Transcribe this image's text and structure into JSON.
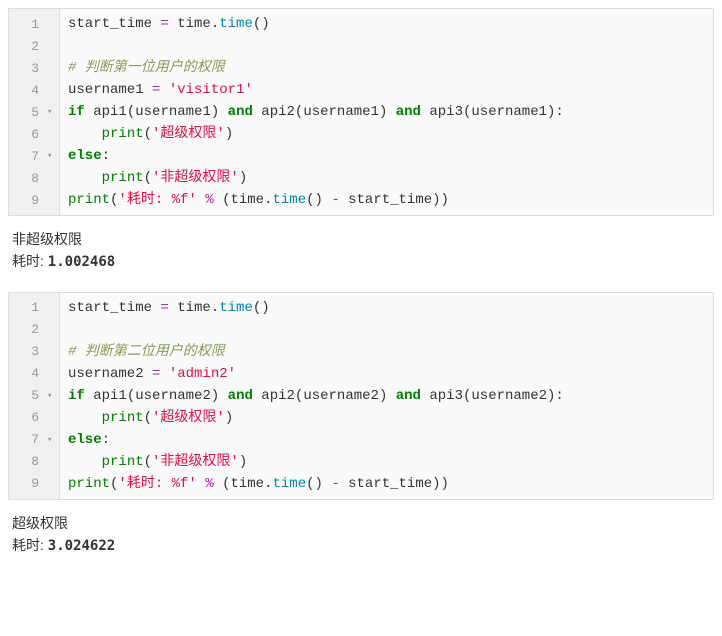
{
  "blocks": [
    {
      "lines": [
        {
          "n": "1",
          "fold": "",
          "tokens": [
            [
              "name",
              "start_time "
            ],
            [
              "op",
              "="
            ],
            [
              "name",
              " time"
            ],
            [
              "punc",
              "."
            ],
            [
              "call",
              "time"
            ],
            [
              "punc",
              "()"
            ]
          ]
        },
        {
          "n": "2",
          "fold": "",
          "tokens": []
        },
        {
          "n": "3",
          "fold": "",
          "tokens": [
            [
              "cmt",
              "# 判断第一位用户的权限"
            ]
          ]
        },
        {
          "n": "4",
          "fold": "",
          "tokens": [
            [
              "name",
              "username1 "
            ],
            [
              "op",
              "="
            ],
            [
              "name",
              " "
            ],
            [
              "str",
              "'visitor1'"
            ]
          ]
        },
        {
          "n": "5",
          "fold": "▾",
          "tokens": [
            [
              "kw",
              "if"
            ],
            [
              "name",
              " api1"
            ],
            [
              "punc",
              "("
            ],
            [
              "name",
              "username1"
            ],
            [
              "punc",
              ")"
            ],
            [
              "name",
              " "
            ],
            [
              "kw",
              "and"
            ],
            [
              "name",
              " api2"
            ],
            [
              "punc",
              "("
            ],
            [
              "name",
              "username1"
            ],
            [
              "punc",
              ")"
            ],
            [
              "name",
              " "
            ],
            [
              "kw",
              "and"
            ],
            [
              "name",
              " api3"
            ],
            [
              "punc",
              "("
            ],
            [
              "name",
              "username1"
            ],
            [
              "punc",
              ")"
            ],
            [
              "punc",
              ":"
            ]
          ]
        },
        {
          "n": "6",
          "fold": "",
          "tokens": [
            [
              "name",
              "    "
            ],
            [
              "builtin",
              "print"
            ],
            [
              "punc",
              "("
            ],
            [
              "str",
              "'超级权限'"
            ],
            [
              "punc",
              ")"
            ]
          ]
        },
        {
          "n": "7",
          "fold": "▾",
          "tokens": [
            [
              "kw",
              "else"
            ],
            [
              "punc",
              ":"
            ]
          ]
        },
        {
          "n": "8",
          "fold": "",
          "tokens": [
            [
              "name",
              "    "
            ],
            [
              "builtin",
              "print"
            ],
            [
              "punc",
              "("
            ],
            [
              "str",
              "'非超级权限'"
            ],
            [
              "punc",
              ")"
            ]
          ]
        },
        {
          "n": "9",
          "fold": "",
          "tokens": [
            [
              "builtin",
              "print"
            ],
            [
              "punc",
              "("
            ],
            [
              "str",
              "'耗时: %f'"
            ],
            [
              "name",
              " "
            ],
            [
              "op",
              "%"
            ],
            [
              "name",
              " "
            ],
            [
              "punc",
              "("
            ],
            [
              "name",
              "time"
            ],
            [
              "punc",
              "."
            ],
            [
              "call",
              "time"
            ],
            [
              "punc",
              "()"
            ],
            [
              "name",
              " "
            ],
            [
              "op",
              "-"
            ],
            [
              "name",
              " start_time"
            ],
            [
              "punc",
              "))"
            ]
          ]
        }
      ],
      "output": {
        "line1": "非超级权限",
        "line2_pre": "耗时: ",
        "line2_val": "1.002468"
      }
    },
    {
      "lines": [
        {
          "n": "1",
          "fold": "",
          "tokens": [
            [
              "name",
              "start_time "
            ],
            [
              "op",
              "="
            ],
            [
              "name",
              " time"
            ],
            [
              "punc",
              "."
            ],
            [
              "call",
              "time"
            ],
            [
              "punc",
              "()"
            ]
          ]
        },
        {
          "n": "2",
          "fold": "",
          "tokens": []
        },
        {
          "n": "3",
          "fold": "",
          "tokens": [
            [
              "cmt",
              "# 判断第二位用户的权限"
            ]
          ]
        },
        {
          "n": "4",
          "fold": "",
          "tokens": [
            [
              "name",
              "username2 "
            ],
            [
              "op",
              "="
            ],
            [
              "name",
              " "
            ],
            [
              "str",
              "'admin2'"
            ]
          ]
        },
        {
          "n": "5",
          "fold": "▾",
          "tokens": [
            [
              "kw",
              "if"
            ],
            [
              "name",
              " api1"
            ],
            [
              "punc",
              "("
            ],
            [
              "name",
              "username2"
            ],
            [
              "punc",
              ")"
            ],
            [
              "name",
              " "
            ],
            [
              "kw",
              "and"
            ],
            [
              "name",
              " api2"
            ],
            [
              "punc",
              "("
            ],
            [
              "name",
              "username2"
            ],
            [
              "punc",
              ")"
            ],
            [
              "name",
              " "
            ],
            [
              "kw",
              "and"
            ],
            [
              "name",
              " api3"
            ],
            [
              "punc",
              "("
            ],
            [
              "name",
              "username2"
            ],
            [
              "punc",
              ")"
            ],
            [
              "punc",
              ":"
            ]
          ]
        },
        {
          "n": "6",
          "fold": "",
          "tokens": [
            [
              "name",
              "    "
            ],
            [
              "builtin",
              "print"
            ],
            [
              "punc",
              "("
            ],
            [
              "str",
              "'超级权限'"
            ],
            [
              "punc",
              ")"
            ]
          ]
        },
        {
          "n": "7",
          "fold": "▾",
          "tokens": [
            [
              "kw",
              "else"
            ],
            [
              "punc",
              ":"
            ]
          ]
        },
        {
          "n": "8",
          "fold": "",
          "tokens": [
            [
              "name",
              "    "
            ],
            [
              "builtin",
              "print"
            ],
            [
              "punc",
              "("
            ],
            [
              "str",
              "'非超级权限'"
            ],
            [
              "punc",
              ")"
            ]
          ]
        },
        {
          "n": "9",
          "fold": "",
          "tokens": [
            [
              "builtin",
              "print"
            ],
            [
              "punc",
              "("
            ],
            [
              "str",
              "'耗时: %f'"
            ],
            [
              "name",
              " "
            ],
            [
              "op",
              "%"
            ],
            [
              "name",
              " "
            ],
            [
              "punc",
              "("
            ],
            [
              "name",
              "time"
            ],
            [
              "punc",
              "."
            ],
            [
              "call",
              "time"
            ],
            [
              "punc",
              "()"
            ],
            [
              "name",
              " "
            ],
            [
              "op",
              "-"
            ],
            [
              "name",
              " start_time"
            ],
            [
              "punc",
              "))"
            ]
          ]
        }
      ],
      "output": {
        "line1": "超级权限",
        "line2_pre": "耗时: ",
        "line2_val": "3.024622"
      }
    }
  ]
}
